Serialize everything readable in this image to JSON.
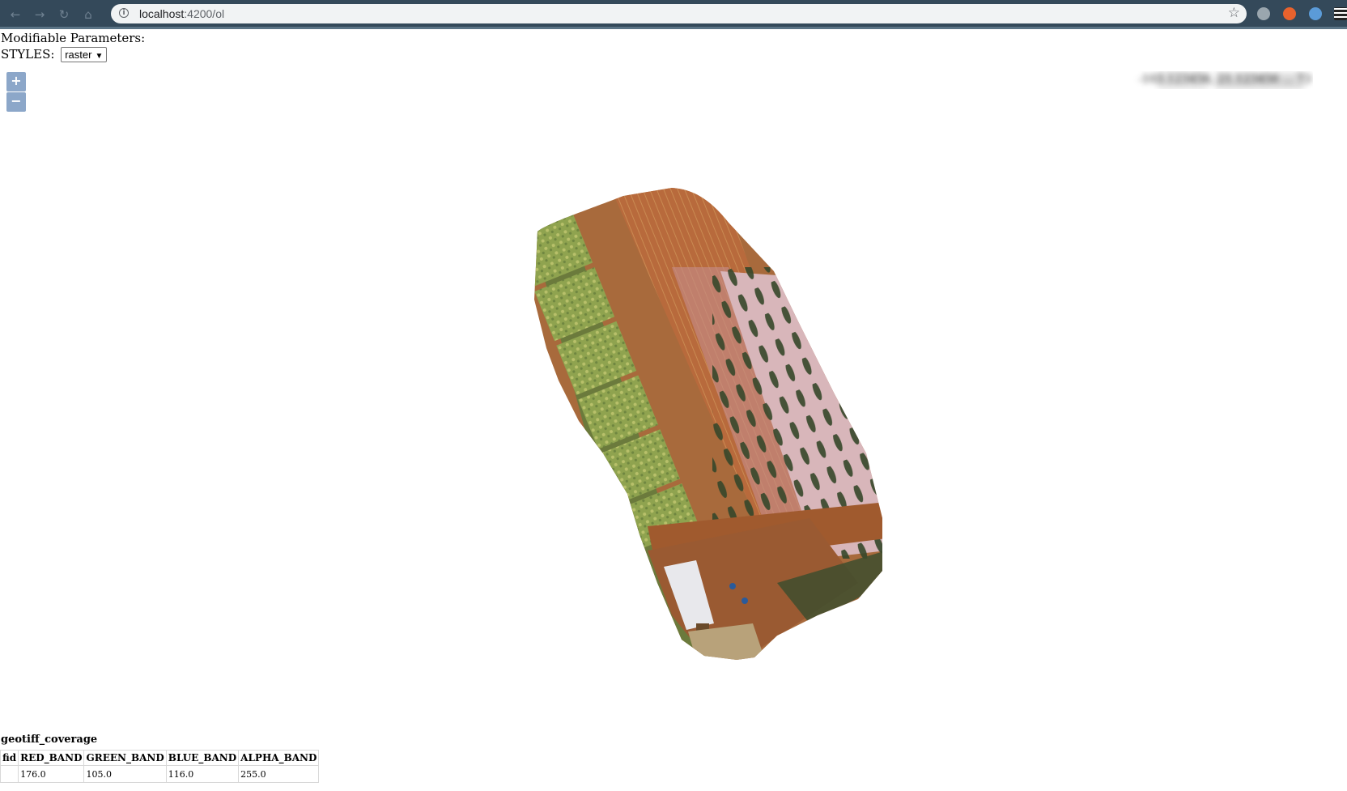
{
  "browser": {
    "nav": {
      "back_icon": "back-arrow-icon",
      "forward_icon": "forward-arrow-icon",
      "reload_icon": "reload-icon",
      "home_icon": "home-icon"
    },
    "url_host": "localhost",
    "url_rest": ":4200/ol",
    "bookmark_icon": "star-icon",
    "extensions": [
      "camera-extension-icon",
      "orange-extension-icon",
      "blue-extension-icon",
      "flag-extension-icon"
    ]
  },
  "page": {
    "params_label": "Modifiable Parameters:",
    "styles_label": "STYLES:",
    "styles_selected": "raster",
    "caret_glyph": "▼"
  },
  "map": {
    "zoom_in": "+",
    "zoom_out": "−",
    "coordinate_readout": "-103.123456, 21.123456 ... 73",
    "coordinate_readout_blurred": true,
    "colors": {
      "field_red": "#b86a3c",
      "field_pink": "#c58a86",
      "crop_green": "#9aa65a",
      "soil": "#9a5a32",
      "orchard_bg": "#d8b6ba",
      "tree_dark": "#3a4a2a"
    }
  },
  "feature_info": {
    "title": "geotiff_coverage",
    "columns": [
      "fid",
      "RED_BAND",
      "GREEN_BAND",
      "BLUE_BAND",
      "ALPHA_BAND"
    ],
    "rows": [
      [
        "",
        "176.0",
        "105.0",
        "116.0",
        "255.0"
      ]
    ]
  }
}
